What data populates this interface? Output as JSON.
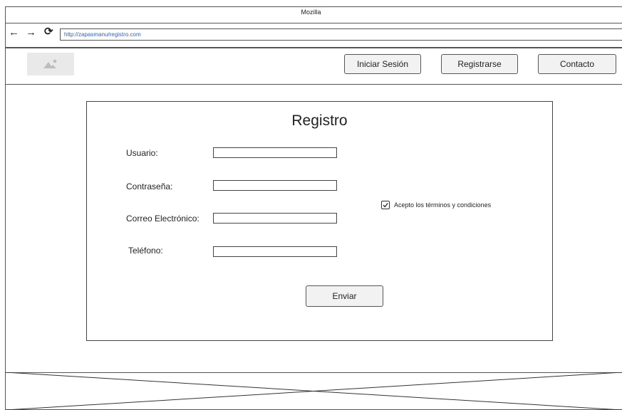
{
  "window": {
    "title": "Mozilla"
  },
  "browser": {
    "back_icon": "arrow-left-icon",
    "forward_icon": "arrow-right-icon",
    "reload_icon": "reload-icon",
    "url": "http://zapasmanu/registro.com"
  },
  "header": {
    "logo_icon": "image-placeholder-icon",
    "nav": [
      {
        "label": "Iniciar Sesión"
      },
      {
        "label": "Registrarse"
      },
      {
        "label": "Contacto"
      }
    ]
  },
  "form": {
    "title": "Registro",
    "fields": [
      {
        "label": "Usuario:",
        "value": ""
      },
      {
        "label": "Contraseña:",
        "value": ""
      },
      {
        "label": "Correo Electrónico:",
        "value": ""
      },
      {
        "label": "Teléfono:",
        "value": ""
      }
    ],
    "terms": {
      "label": "Acepto los términos y condiciones",
      "checked": true
    },
    "submit_label": "Enviar"
  },
  "footer": {
    "placeholder_icon": "image-placeholder-icon"
  },
  "colors": {
    "url_text": "#2c62c9",
    "border": "#555555",
    "button_bg": "#f2f2f2"
  }
}
